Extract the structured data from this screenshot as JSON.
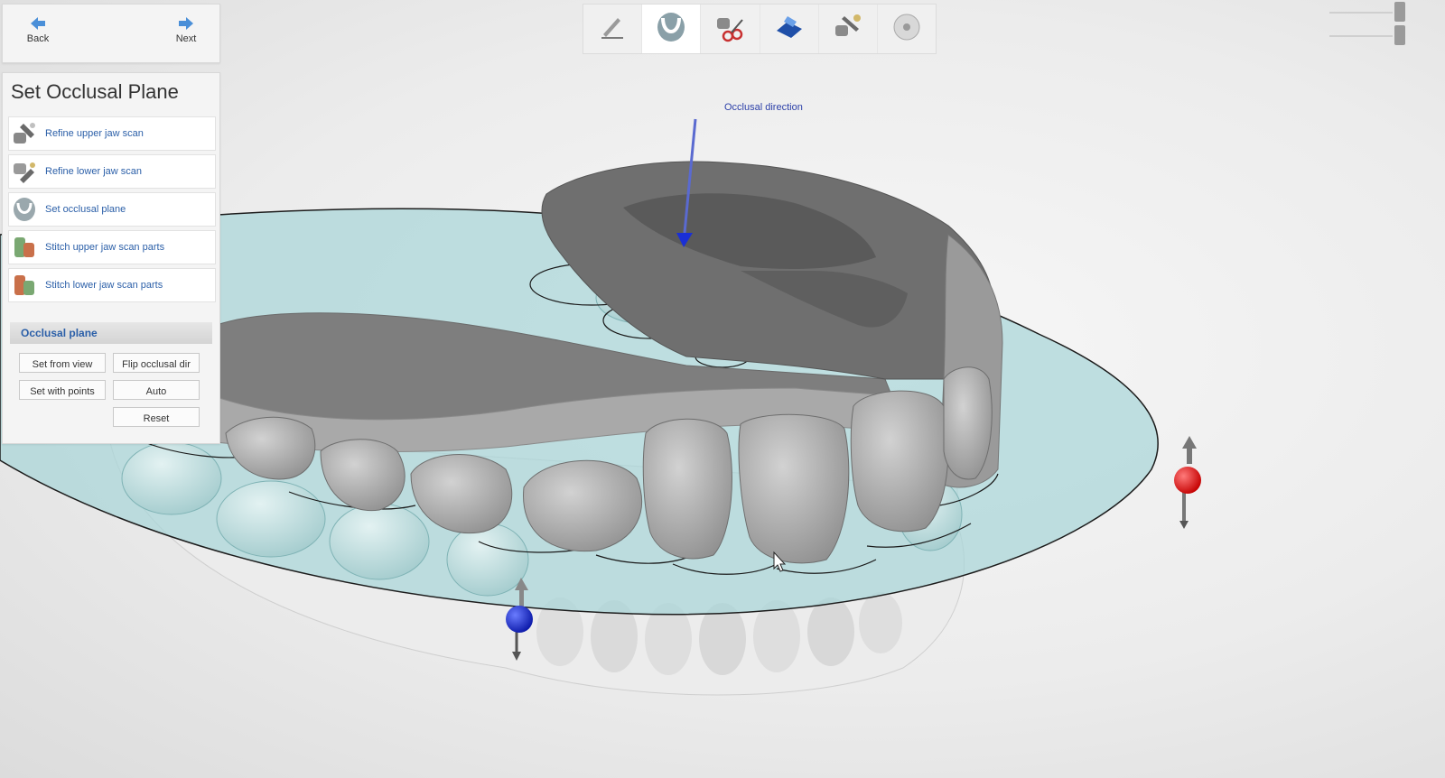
{
  "navigation": {
    "back_label": "Back",
    "next_label": "Next"
  },
  "panel": {
    "title": "Set Occlusal Plane",
    "steps": [
      {
        "label": "Refine upper jaw scan",
        "icon": "refine-upper-jaw-icon"
      },
      {
        "label": "Refine lower jaw scan",
        "icon": "refine-lower-jaw-icon"
      },
      {
        "label": "Set occlusal plane",
        "icon": "occlusal-plane-icon"
      },
      {
        "label": "Stitch upper jaw scan parts",
        "icon": "stitch-upper-jaw-icon"
      },
      {
        "label": "Stitch lower jaw scan parts",
        "icon": "stitch-lower-jaw-icon"
      }
    ]
  },
  "occlusal_plane": {
    "header": "Occlusal plane",
    "buttons": {
      "set_from_view": "Set from view",
      "flip_occlusal_dir": "Flip occlusal dir",
      "set_with_points": "Set with points",
      "auto": "Auto",
      "reset": "Reset"
    }
  },
  "toolbar": {
    "tools": [
      "pencil-icon",
      "jaw-arch-icon",
      "scissors-icon",
      "model-base-icon",
      "refine-tools-icon",
      "disc-icon"
    ],
    "active_index": 1
  },
  "viewport": {
    "occlusal_direction_label": "Occlusal direction"
  },
  "colors": {
    "accent_blue": "#2b5fa8",
    "plane_fill": "#a9d6d8",
    "handle_red": "#e02020",
    "handle_blue": "#1a2fd6"
  }
}
